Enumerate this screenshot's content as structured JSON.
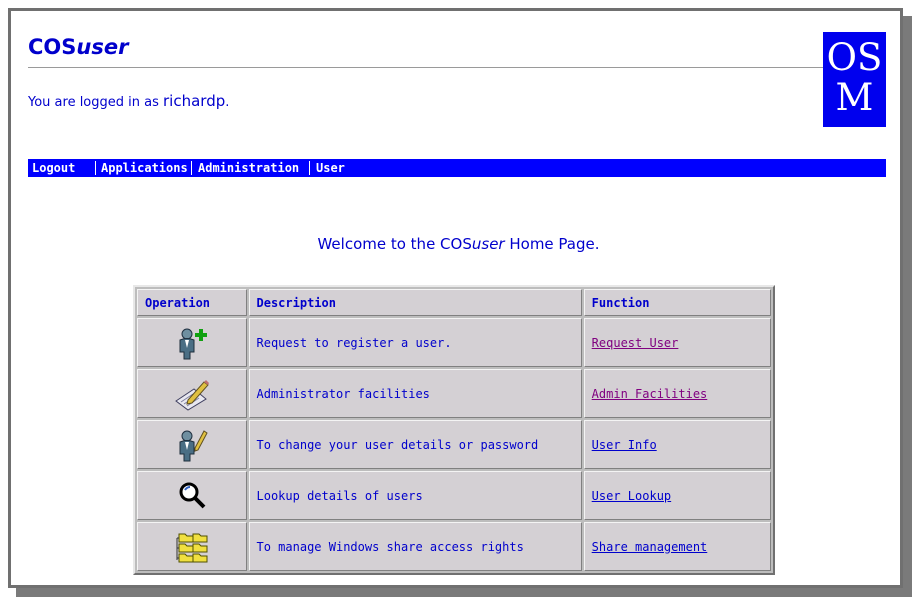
{
  "header": {
    "title_prefix": "COS",
    "title_suffix": "user",
    "logged_in_text": "You are logged in as ",
    "username": "richardp",
    "logo": {
      "line1": "OS",
      "line2": "M"
    }
  },
  "nav": {
    "items": [
      {
        "label": "Logout"
      },
      {
        "label": "Applications"
      },
      {
        "label": "Administration"
      },
      {
        "label": "User"
      }
    ]
  },
  "welcome": {
    "prefix": "Welcome to the COS",
    "italic": "user",
    "suffix": " Home Page."
  },
  "table": {
    "headers": [
      "Operation",
      "Description",
      "Function"
    ],
    "rows": [
      {
        "icon": "add-user-icon",
        "description": "Request to register a user.",
        "function": "Request User",
        "visited": true
      },
      {
        "icon": "edit-document-pencil-icon",
        "description": "Administrator facilities",
        "function": "Admin Facilities",
        "visited": true
      },
      {
        "icon": "user-edit-icon",
        "description": "To change your user details or password",
        "function": "User Info",
        "visited": false
      },
      {
        "icon": "magnifier-icon",
        "description": "Lookup details of users",
        "function": "User Lookup",
        "visited": false
      },
      {
        "icon": "shared-folders-icon",
        "description": "To manage Windows share access rights",
        "function": "Share management",
        "visited": false
      }
    ]
  },
  "colors": {
    "nav_bg": "#0000ff",
    "text": "#0000cc",
    "visited_link": "#800080",
    "logo_bg": "#0000ee"
  }
}
